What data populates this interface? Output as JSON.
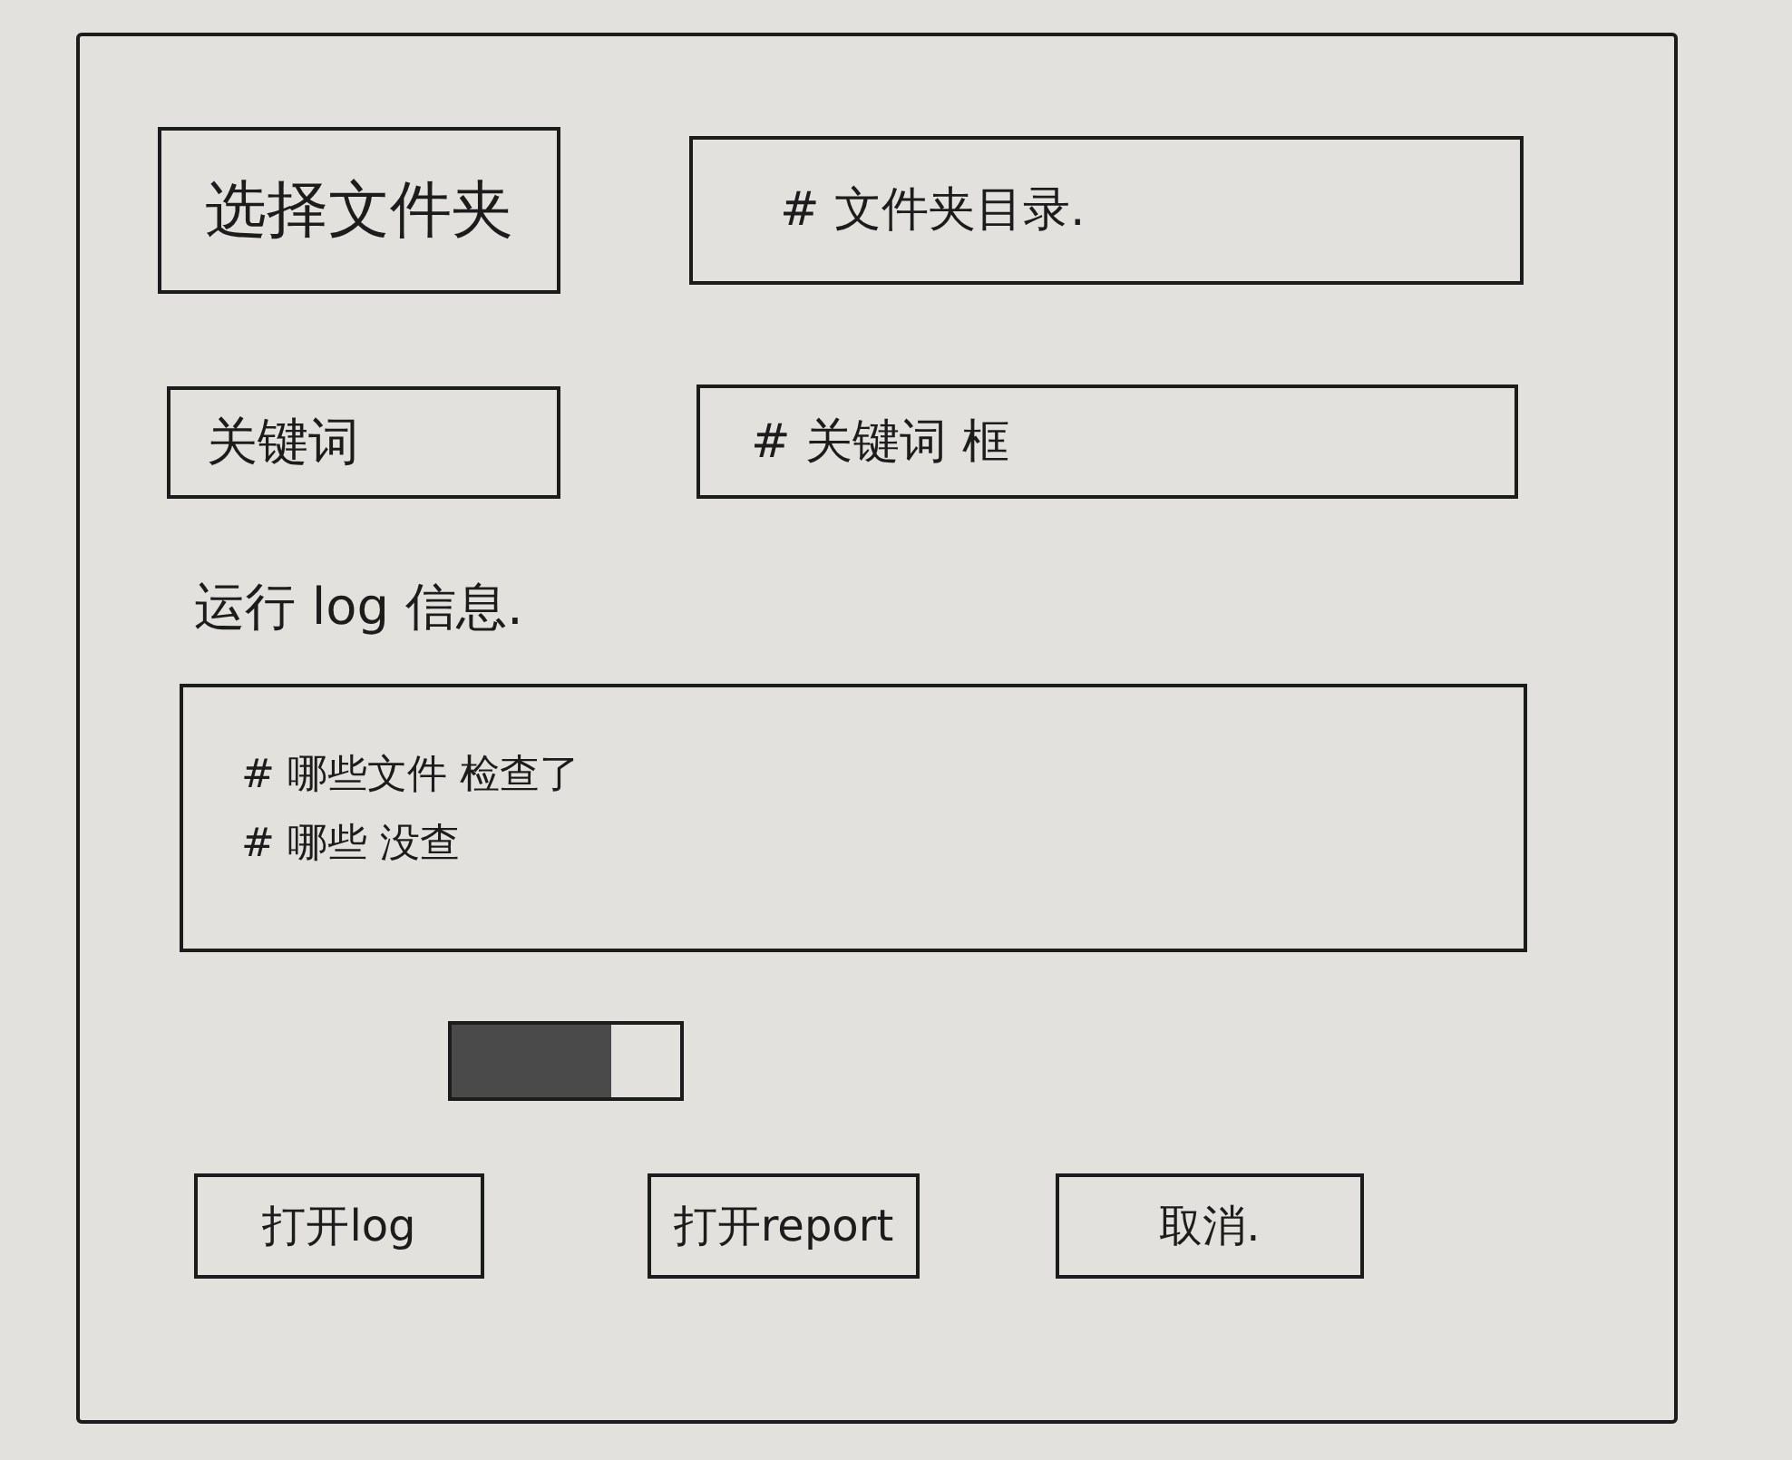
{
  "folder_row": {
    "button": "选择文件夹",
    "field": {
      "placeholder": "# 文件夹目录."
    }
  },
  "keyword_row": {
    "label": "关键词",
    "field": {
      "placeholder": "# 关键词 框"
    }
  },
  "log": {
    "label": "运行 log 信息.",
    "lines": [
      "# 哪些文件 检查了",
      "# 哪些 没查"
    ]
  },
  "progress": {
    "level": 0.7
  },
  "buttons": [
    "打开log",
    "打开report",
    "取消."
  ]
}
